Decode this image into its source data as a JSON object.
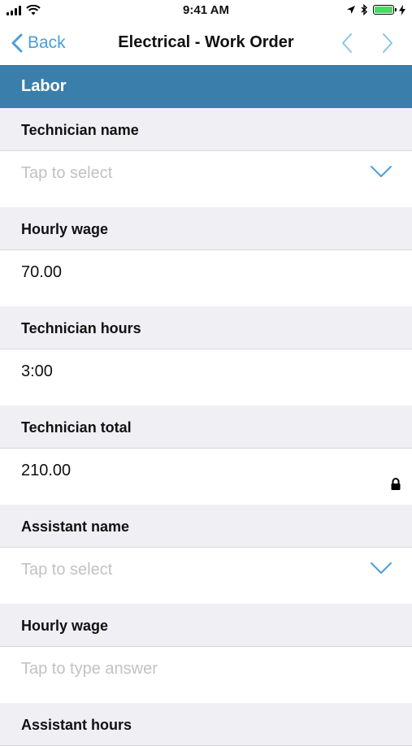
{
  "status_bar": {
    "time": "9:41 AM",
    "icons": [
      "signal-icon",
      "wifi-icon",
      "location-icon",
      "bluetooth-icon",
      "battery-icon",
      "charging-icon"
    ]
  },
  "nav": {
    "back_label": "Back",
    "title": "Electrical - Work Order",
    "accent": "#4a9fd8"
  },
  "section": {
    "title": "Labor",
    "color": "#3a7fab"
  },
  "fields": [
    {
      "label": "Technician name",
      "value": "",
      "placeholder": "Tap to select",
      "type": "select"
    },
    {
      "label": "Hourly wage",
      "value": "70.00",
      "placeholder": "",
      "type": "text"
    },
    {
      "label": "Technician hours",
      "value": "3:00",
      "placeholder": "",
      "type": "text"
    },
    {
      "label": "Technician total",
      "value": "210.00",
      "placeholder": "",
      "type": "locked"
    },
    {
      "label": "Assistant name",
      "value": "",
      "placeholder": "Tap to select",
      "type": "select"
    },
    {
      "label": "Hourly wage",
      "value": "",
      "placeholder": "Tap to type answer",
      "type": "text"
    },
    {
      "label": "Assistant hours",
      "value": "",
      "placeholder": "",
      "type": "text"
    }
  ]
}
